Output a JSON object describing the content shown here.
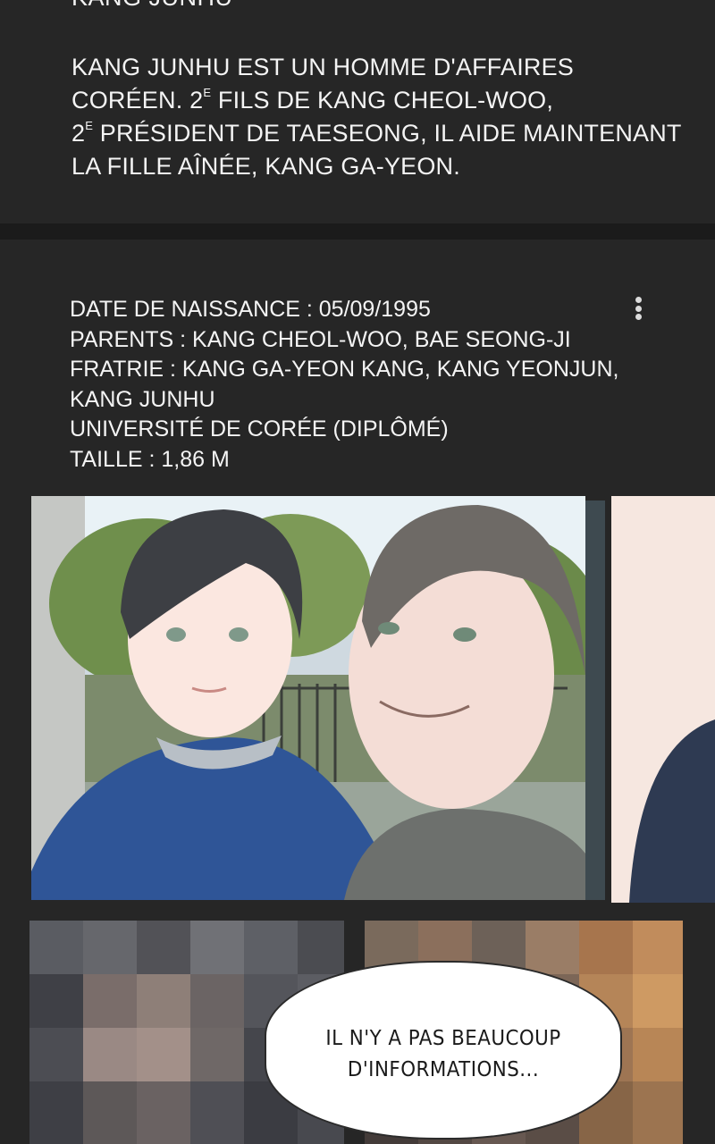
{
  "top_card": {
    "cut_title": "KANG JUNHU",
    "bio": {
      "line1": "KANG JUNHU EST UN HOMME D'AFFAIRES",
      "line2_a": "CORÉEN. 2",
      "line2_sup": "E",
      "line2_b": " FILS DE  KANG CHEOL-WOO,",
      "line3_a": "2",
      "line3_sup": "E",
      "line3_b": " PRÉSIDENT DE TAESEONG, IL AIDE MAINTENANT",
      "line4": "LA FILLE AÎNÉE, KANG GA-YEON."
    }
  },
  "facts": {
    "birth": "DATE DE NAISSANCE : 05/09/1995",
    "parents": "PARENTS : KANG CHEOL-WOO, BAE SEONG-JI",
    "siblings": "FRATRIE : KANG GA-YEON KANG, KANG YEONJUN,",
    "siblings_cont": "KANG JUNHU",
    "education": "UNIVERSITÉ DE CORÉE (DIPLÔMÉ)",
    "height": "TAILLE : 1,86 M"
  },
  "more_icon": "vertical-ellipsis-icon",
  "bubble": {
    "line1": "IL N'Y A PAS BEAUCOUP",
    "line2": "D'INFORMATIONS..."
  },
  "colors": {
    "background": "#222222",
    "card": "#262626",
    "divider": "#1b1b1b",
    "text": "#f4f4f4"
  }
}
